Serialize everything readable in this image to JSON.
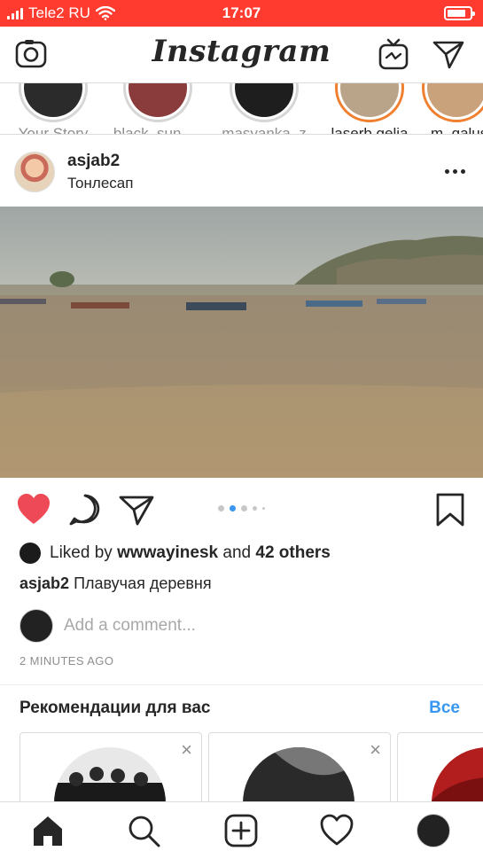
{
  "status_bar": {
    "carrier": "Tele2 RU",
    "time": "17:07"
  },
  "header": {
    "logo": "Instagram",
    "icons": [
      "camera-icon",
      "igtv-icon",
      "direct-icon"
    ]
  },
  "stories": [
    {
      "name": "Your Story",
      "seen": true
    },
    {
      "name": "black_sun_...",
      "seen": true
    },
    {
      "name": "masyanka_z",
      "seen": true
    },
    {
      "name": "laserb.gelia",
      "seen": false
    },
    {
      "name": "m_galus",
      "seen": false
    }
  ],
  "post": {
    "username": "asjab2",
    "location": "Тонлесап",
    "carousel": {
      "count": 5,
      "active_index": 1
    },
    "likes": {
      "prefix": "Liked by",
      "liker": "wwwayinesk",
      "connector": "and",
      "others": "42 others"
    },
    "caption": {
      "username": "asjab2",
      "text": "Плавучая деревня"
    },
    "comment_placeholder": "Add a comment...",
    "time_ago": "2 MINUTES AGO"
  },
  "recommendations": {
    "title": "Рекомендации для вас",
    "see_all": "Все",
    "close_glyph": "×"
  },
  "tab_bar": [
    "home-icon",
    "search-icon",
    "new-post-icon",
    "activity-icon",
    "profile-icon"
  ],
  "colors": {
    "status_bar": "#ff3b30",
    "like_active": "#ed4956",
    "accent": "#3897f0",
    "story_ring": "#f08030"
  }
}
